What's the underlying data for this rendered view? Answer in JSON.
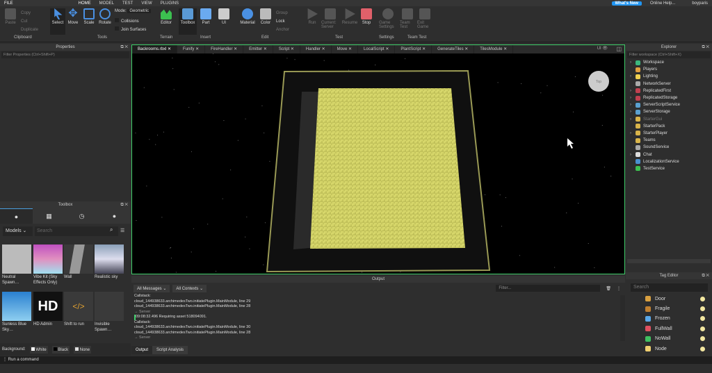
{
  "menu": {
    "file": "FILE",
    "tabs": [
      "HOME",
      "MODEL",
      "TEST",
      "VIEW",
      "PLUGINS"
    ],
    "whats_new": "What's New",
    "help": "Online Help...",
    "user": "boyparis"
  },
  "ribbon": {
    "clipboard": {
      "paste": "Paste",
      "copy": "Copy",
      "cut": "Cut",
      "duplicate": "Duplicate",
      "group": "Clipboard"
    },
    "tools": {
      "select": "Select",
      "move": "Move",
      "scale": "Scale",
      "rotate": "Rotate",
      "mode_label": "Mode:",
      "mode_value": "Geometric",
      "collisions": "Collisions",
      "join": "Join Surfaces",
      "group": "Tools"
    },
    "terrain": {
      "editor": "Editor",
      "group": "Terrain"
    },
    "insert": {
      "toolbox": "Toolbox",
      "part": "Part",
      "ui": "UI",
      "group": "Insert"
    },
    "edit": {
      "material": "Material",
      "color": "Color",
      "group_btn": "Group",
      "lock": "Lock",
      "anchor": "Anchor",
      "group": "Edit"
    },
    "test": {
      "run": "Run",
      "current": "Current: Server",
      "resume": "Resume",
      "stop": "Stop",
      "group": "Test"
    },
    "settings": {
      "game": "Game Settings",
      "group": "Settings"
    },
    "teamtest": {
      "team": "Team Test",
      "exit": "Exit Game",
      "group": "Team Test"
    }
  },
  "properties": {
    "title": "Properties",
    "filter": "Filter Properties (Ctrl+Shift+P)"
  },
  "toolbox": {
    "title": "Toolbox",
    "category": "Models",
    "search_placeholder": "Search",
    "items": [
      "Neutral Spawn…",
      "Vibe Kit (Sky Effects Only)",
      "Wall",
      "Realistic sky",
      "Sunless Blue Sky…",
      "HD Admin",
      "Shift to run",
      "Invisible Spawn…"
    ],
    "hd_text": "HD",
    "background_label": "Background:",
    "bg_options": [
      "White",
      "Black",
      "None"
    ]
  },
  "command": {
    "placeholder": "Run a command"
  },
  "editor_tabs": [
    "Backrooms.rbxl",
    "Funify",
    "FireHandler",
    "Emitter",
    "Script",
    "Handler",
    "Move",
    "LocalScript",
    "PlantScript",
    "GenerateTiles",
    "TilesModule"
  ],
  "viewport": {
    "ui_toggle": "UI",
    "cube_label": "Top"
  },
  "output": {
    "title": "Output",
    "filter_messages": "All Messages",
    "filter_contexts": "All Contexts",
    "filter_placeholder": "Filter...",
    "lines": [
      "Callstack:",
      "cloud_144938633.archimedesTwo.initiatePlugin.MainModule, line 29",
      "cloud_144938633.archimedesTwo.initiatePlugin.MainModule, line 28",
      "→ Server",
      "09:08:32.496  Requiring asset 518094091.",
      "Callstack:",
      "cloud_144938633.archimedesTwo.initiatePlugin.MainModule, line 30",
      "cloud_144938633.archimedesTwo.initiatePlugin.MainModule, line 28",
      "→ Server"
    ],
    "tabs": [
      "Output",
      "Script Analysis"
    ]
  },
  "explorer": {
    "title": "Explorer",
    "filter": "Filter workspace (Ctrl+Shift+X)",
    "items": [
      {
        "name": "Workspace",
        "color": "#3bb77e",
        "arrow": true
      },
      {
        "name": "Players",
        "color": "#e0a040",
        "arrow": false
      },
      {
        "name": "Lighting",
        "color": "#f0d050",
        "arrow": true
      },
      {
        "name": "NetworkServer",
        "color": "#aaaaaa",
        "arrow": false
      },
      {
        "name": "ReplicatedFirst",
        "color": "#c04050",
        "arrow": true
      },
      {
        "name": "ReplicatedStorage",
        "color": "#c04050",
        "arrow": true
      },
      {
        "name": "ServerScriptService",
        "color": "#5aa0d0",
        "arrow": true
      },
      {
        "name": "ServerStorage",
        "color": "#5aa0d0",
        "arrow": true
      },
      {
        "name": "StarterGui",
        "color": "#d9b44a",
        "arrow": true,
        "dim": true
      },
      {
        "name": "StarterPack",
        "color": "#d9b44a",
        "arrow": false
      },
      {
        "name": "StarterPlayer",
        "color": "#d9b44a",
        "arrow": true
      },
      {
        "name": "Teams",
        "color": "#d9b44a",
        "arrow": false
      },
      {
        "name": "SoundService",
        "color": "#aaaaaa",
        "arrow": false
      },
      {
        "name": "Chat",
        "color": "#dddddd",
        "arrow": true
      },
      {
        "name": "LocalizationService",
        "color": "#4a90d0",
        "arrow": false
      },
      {
        "name": "TestService",
        "color": "#3cc050",
        "arrow": false
      }
    ]
  },
  "tag_editor": {
    "title": "Tag Editor",
    "search_placeholder": "Search",
    "tags": [
      {
        "name": "Door",
        "color": "#d9a040"
      },
      {
        "name": "Fragile",
        "color": "#c08030"
      },
      {
        "name": "Frozen",
        "color": "#5aa8e8"
      },
      {
        "name": "FullWall",
        "color": "#e05060"
      },
      {
        "name": "NoWall",
        "color": "#40c060"
      },
      {
        "name": "Node",
        "color": "#f0d070"
      }
    ]
  },
  "colors": {
    "accent": "#3fcf6a",
    "whats_new": "#2196f3",
    "stop": "#e0606a",
    "maze": "#d6d66a"
  }
}
